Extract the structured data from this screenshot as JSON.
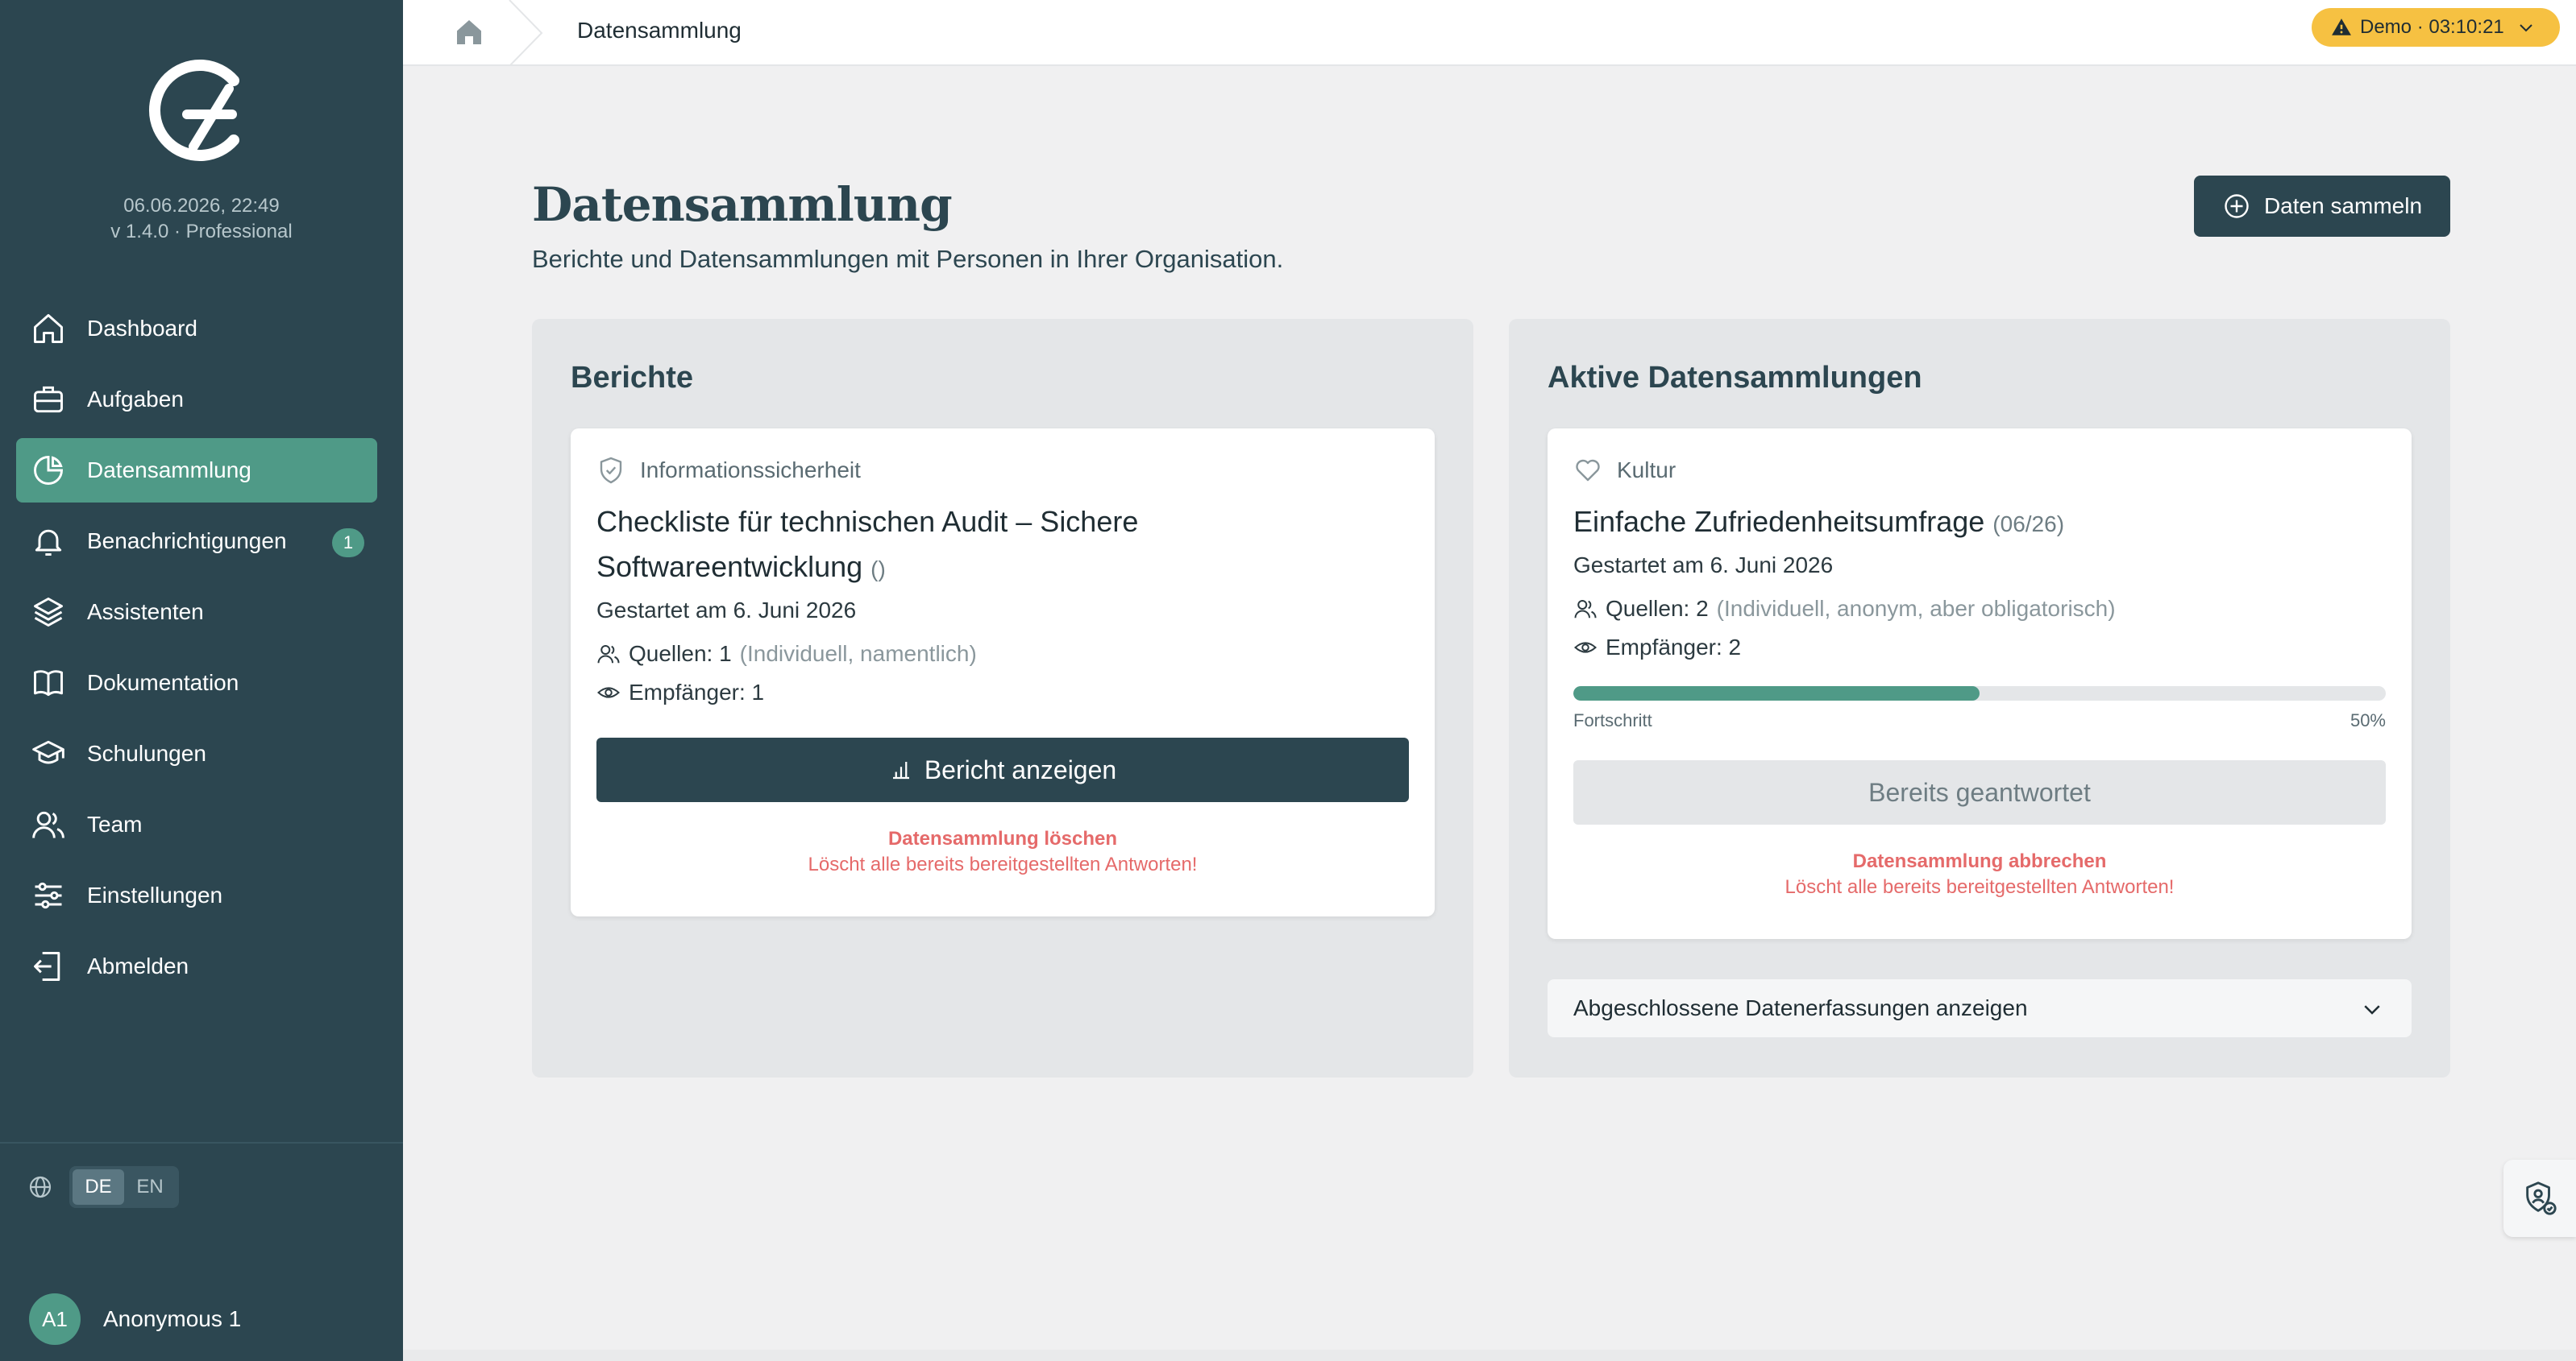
{
  "sidebar": {
    "datetime": "06.06.2026, 22:49",
    "version": "v 1.4.0 · Professional",
    "items": [
      {
        "label": "Dashboard",
        "icon": "home-icon"
      },
      {
        "label": "Aufgaben",
        "icon": "briefcase-icon"
      },
      {
        "label": "Datensammlung",
        "icon": "pie-chart-icon",
        "active": true
      },
      {
        "label": "Benachrichtigungen",
        "icon": "bell-icon",
        "badge": "1"
      },
      {
        "label": "Assistenten",
        "icon": "layers-icon"
      },
      {
        "label": "Dokumentation",
        "icon": "book-icon"
      },
      {
        "label": "Schulungen",
        "icon": "graduation-cap-icon"
      },
      {
        "label": "Team",
        "icon": "users-icon"
      },
      {
        "label": "Einstellungen",
        "icon": "sliders-icon"
      },
      {
        "label": "Abmelden",
        "icon": "logout-icon"
      }
    ],
    "languages": [
      "DE",
      "EN"
    ],
    "active_language": "DE",
    "user": {
      "initials": "A1",
      "name": "Anonymous 1"
    }
  },
  "topbar": {
    "breadcrumb": "Datensammlung",
    "demo_label": "Demo · 03:10:21"
  },
  "main": {
    "title": "Datensammlung",
    "subtitle": "Berichte und Datensammlungen mit Personen in Ihrer Organisation.",
    "collect_button": "Daten sammeln",
    "reports": {
      "title": "Berichte",
      "card": {
        "category": "Informationssicherheit",
        "title_line1": "Checkliste für technischen Audit – Sichere",
        "title_line2": "Softwareentwicklung",
        "title_suffix": "()",
        "started": "Gestartet am 6. Juni 2026",
        "sources": "Quellen: 1",
        "sources_note": "(Individuell, namentlich)",
        "recipients": "Empfänger: 1",
        "view_button": "Bericht anzeigen",
        "delete_label": "Datensammlung löschen",
        "delete_note": "Löscht alle bereits bereitgestellten Antworten!"
      }
    },
    "active": {
      "title": "Aktive Datensammlungen",
      "card": {
        "category": "Kultur",
        "title": "Einfache Zufriedenheitsumfrage",
        "title_suffix": "(06/26)",
        "started": "Gestartet am 6. Juni 2026",
        "sources": "Quellen: 2",
        "sources_note": "(Individuell, anonym, aber obligatorisch)",
        "recipients": "Empfänger: 2",
        "progress_label": "Fortschritt",
        "progress_value": "50%",
        "progress_fraction": 0.5,
        "answered_button": "Bereits geantwortet",
        "cancel_label": "Datensammlung abbrechen",
        "cancel_note": "Löscht alle bereits bereitgestellten Antworten!"
      },
      "completed_toggle": "Abgeschlossene Datenerfassungen anzeigen"
    }
  },
  "colors": {
    "sidebar": "#2c4650",
    "accent": "#4f9a87",
    "demo": "#f6c142",
    "danger": "#e56a6a"
  }
}
